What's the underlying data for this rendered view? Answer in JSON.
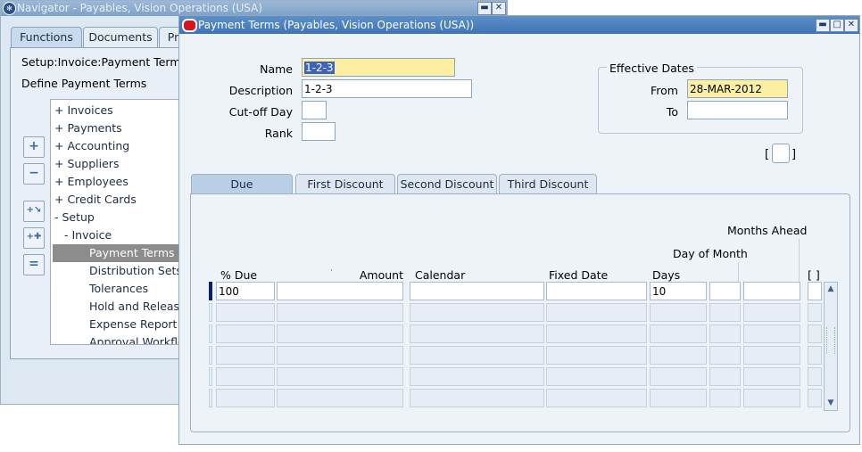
{
  "navigator": {
    "title": "Navigator - Payables, Vision Operations (USA)",
    "title_buttons": {
      "minimize": "▬",
      "close": "✕"
    },
    "tabs": [
      {
        "label": "Functions",
        "active": true
      },
      {
        "label": "Documents",
        "active": false
      },
      {
        "label": "Pr",
        "active": false
      }
    ],
    "path": "Setup:Invoice:Payment Terms",
    "subtitle": "Define Payment Terms",
    "tree_items": [
      {
        "label": "+  Invoices",
        "indent": 0
      },
      {
        "label": "+  Payments",
        "indent": 0
      },
      {
        "label": "+  Accounting",
        "indent": 0
      },
      {
        "label": "+  Suppliers",
        "indent": 0
      },
      {
        "label": "+  Employees",
        "indent": 0
      },
      {
        "label": "+  Credit Cards",
        "indent": 0
      },
      {
        "label": "-  Setup",
        "indent": 0
      },
      {
        "label": "-  Invoice",
        "indent": 1
      },
      {
        "label": "Payment Terms",
        "indent": 2,
        "selected": true
      },
      {
        "label": "Distribution Sets",
        "indent": 2
      },
      {
        "label": "Tolerances",
        "indent": 2
      },
      {
        "label": "Hold and Release",
        "indent": 2
      },
      {
        "label": "Expense Report T",
        "indent": 2
      },
      {
        "label": "Approval Workflow",
        "indent": 2
      }
    ],
    "tree_buttons": [
      {
        "name": "expand-button",
        "glyph": "+"
      },
      {
        "name": "collapse-button",
        "glyph": "−"
      },
      {
        "name": "expand-branch-button",
        "glyph": "+↘"
      },
      {
        "name": "expand-all-button",
        "glyph": "+✚"
      },
      {
        "name": "collapse-all-button",
        "glyph": "="
      }
    ]
  },
  "payment_terms": {
    "title": "Payment Terms (Payables, Vision Operations (USA))",
    "title_buttons": {
      "minimize": "▬",
      "maximize": "□",
      "close": "✕"
    },
    "fields": {
      "name_label": "Name",
      "name_value": "1-2-3",
      "description_label": "Description",
      "description_value": "1-2-3",
      "cutoff_label": "Cut-off Day",
      "cutoff_value": "",
      "rank_label": "Rank",
      "rank_value": ""
    },
    "effective_dates": {
      "legend": "Effective Dates",
      "from_label": "From",
      "from_value": "28-MAR-2012",
      "to_label": "To",
      "to_value": ""
    },
    "dff": {
      "open": "[",
      "close": "]"
    },
    "tabs": [
      {
        "label": "Due",
        "active": true
      },
      {
        "label": "First Discount",
        "active": false
      },
      {
        "label": "Second Discount",
        "active": false
      },
      {
        "label": "Third Discount",
        "active": false
      }
    ],
    "grid": {
      "headers": {
        "pct_due": "% Due",
        "amount": "Amount",
        "calendar": "Calendar",
        "fixed_date": "Fixed Date",
        "days": "Days",
        "day_of_month": "Day of Month",
        "months_ahead": "Months Ahead",
        "dff": "[ ]"
      },
      "rows": [
        {
          "pct_due": "100",
          "amount": "",
          "calendar": "",
          "fixed_date": "",
          "days": "10",
          "day_of_month": "",
          "months_ahead": ""
        },
        {
          "pct_due": "",
          "amount": "",
          "calendar": "",
          "fixed_date": "",
          "days": "",
          "day_of_month": "",
          "months_ahead": ""
        },
        {
          "pct_due": "",
          "amount": "",
          "calendar": "",
          "fixed_date": "",
          "days": "",
          "day_of_month": "",
          "months_ahead": ""
        },
        {
          "pct_due": "",
          "amount": "",
          "calendar": "",
          "fixed_date": "",
          "days": "",
          "day_of_month": "",
          "months_ahead": ""
        },
        {
          "pct_due": "",
          "amount": "",
          "calendar": "",
          "fixed_date": "",
          "days": "",
          "day_of_month": "",
          "months_ahead": ""
        },
        {
          "pct_due": "",
          "amount": "",
          "calendar": "",
          "fixed_date": "",
          "days": "",
          "day_of_month": "",
          "months_ahead": ""
        }
      ],
      "scroll": {
        "up": "▲",
        "down": "▼"
      }
    }
  }
}
